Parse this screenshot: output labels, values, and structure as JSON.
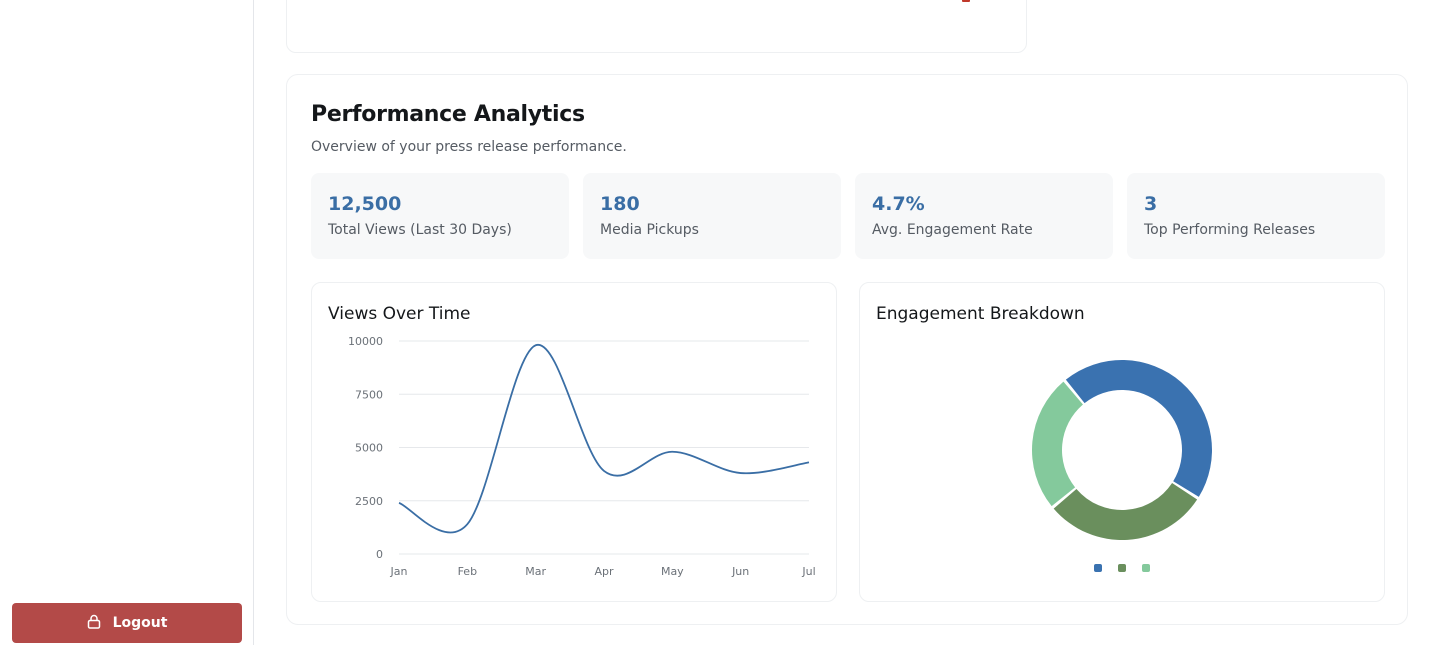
{
  "sidebar": {
    "logout_label": "Logout",
    "logout_icon": "lock-icon",
    "logout_color": "#b34a48"
  },
  "analytics": {
    "title": "Performance Analytics",
    "subtitle": "Overview of your press release performance.",
    "stats": [
      {
        "value": "12,500",
        "label": "Total Views (Last 30 Days)"
      },
      {
        "value": "180",
        "label": "Media Pickups"
      },
      {
        "value": "4.7%",
        "label": "Avg. Engagement Rate"
      },
      {
        "value": "3",
        "label": "Top Performing Releases"
      }
    ]
  },
  "chart_data": [
    {
      "type": "line",
      "title": "Views Over Time",
      "categories": [
        "Jan",
        "Feb",
        "Mar",
        "Apr",
        "May",
        "Jun",
        "Jul"
      ],
      "series": [
        {
          "values": [
            2400,
            1400,
            9800,
            3900,
            4800,
            3800,
            4300
          ],
          "color": "#3a6ea5"
        }
      ],
      "ylim": [
        0,
        10000
      ],
      "yticks": [
        "0",
        "2500",
        "5000",
        "7500",
        "10000"
      ],
      "grid": true
    },
    {
      "type": "pie",
      "title": "Engagement Breakdown",
      "donut": true,
      "values": [
        45,
        30,
        25
      ],
      "colors": [
        "#3a72b0",
        "#6a8f5d",
        "#84c99c"
      ],
      "legend": "bottom"
    }
  ]
}
